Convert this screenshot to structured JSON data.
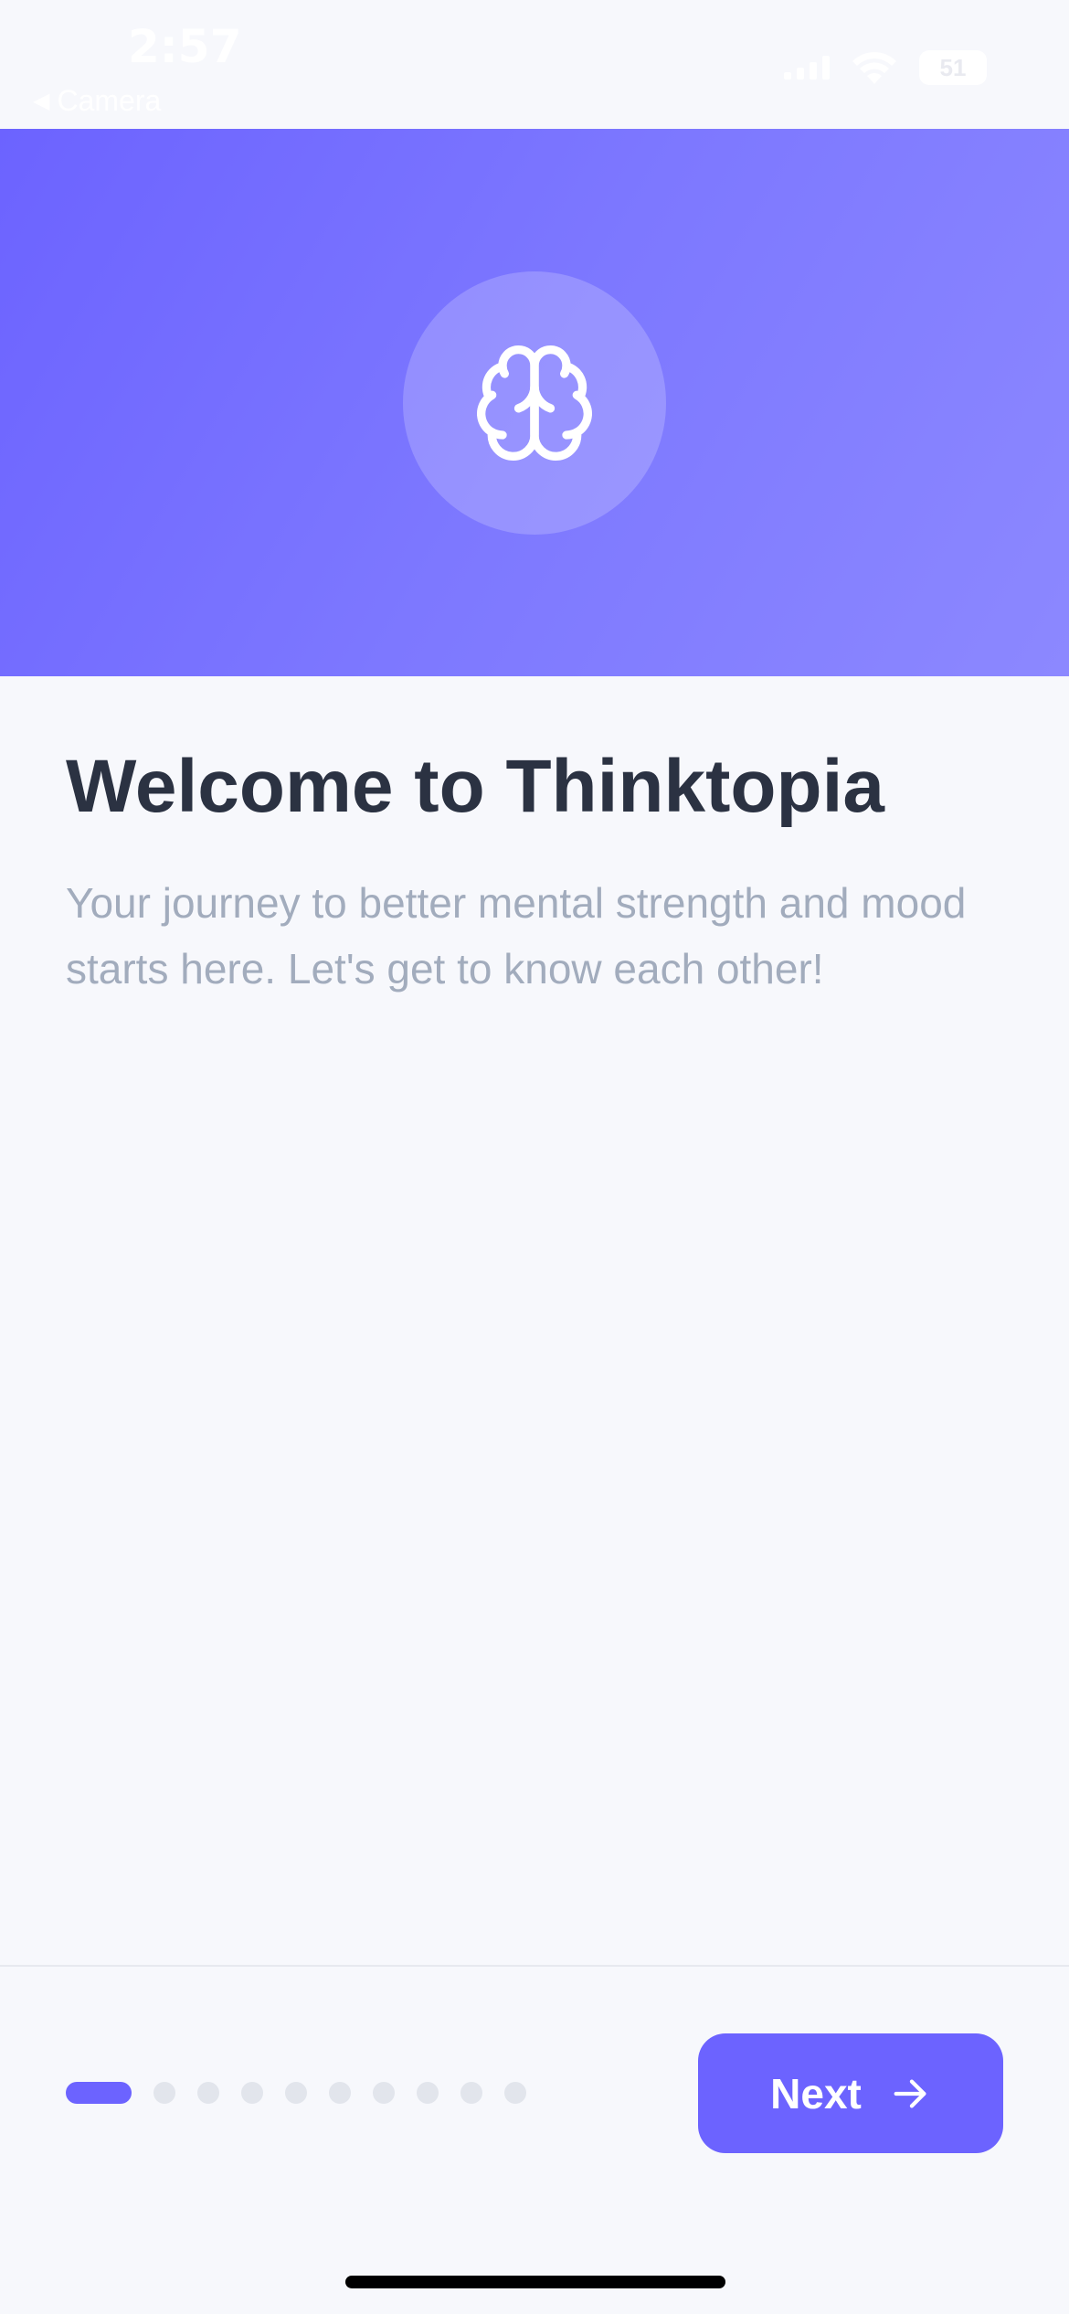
{
  "status_bar": {
    "time": "2:57",
    "back_label": "Camera",
    "battery": "51"
  },
  "hero": {
    "icon": "brain-icon",
    "gradient_start": "#6c63ff",
    "gradient_end": "#8c88ff"
  },
  "content": {
    "title": "Welcome to Thinktopia",
    "subtitle": "Your journey to better mental strength and mood starts here. Let's get to know each other!"
  },
  "pagination": {
    "total_steps": 10,
    "current_step": 1
  },
  "next_button": {
    "label": "Next",
    "icon": "arrow-right-icon",
    "color": "#6c63ff"
  }
}
